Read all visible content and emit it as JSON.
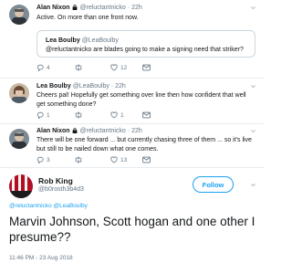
{
  "colors": {
    "accent": "#1da1f2",
    "secondary_text": "#657786",
    "border": "#e6ecf0"
  },
  "tweets": [
    {
      "name": "Alan Nixon",
      "handle": "@reluctantnicko",
      "time": "22h",
      "text": "Active. On more than one front now.",
      "quote": {
        "name": "Lea Boulby",
        "handle": "@LeaBoulby",
        "text": "@reluctantnicko are blades going to make a signing need that striker?"
      },
      "reply_count": "4",
      "retweet_count": "",
      "like_count": "12"
    },
    {
      "name": "Lea Boulby",
      "handle": "@LeaBoulby",
      "time": "22h",
      "text": "Cheers pal! Hopefully get something over line then how confident that well get something done?",
      "reply_count": "1",
      "retweet_count": "",
      "like_count": "1"
    },
    {
      "name": "Alan Nixon",
      "handle": "@reluctantnicko",
      "time": "22h",
      "text": "There will be one forward ... but currently chasing three of them ... so it's live but still to be nailed down what one comes.",
      "reply_count": "3",
      "retweet_count": "",
      "like_count": "13"
    }
  ],
  "main_tweet": {
    "name": "Rob King",
    "handle": "@b0rosth3b4d3",
    "follow_label": "Follow",
    "replying_to": "@reluctantnicko @LeaBoulby",
    "text": "Marvin Johnson, Scott hogan and one other I presume??",
    "timestamp": "11:46 PM - 23 Aug 2018"
  }
}
